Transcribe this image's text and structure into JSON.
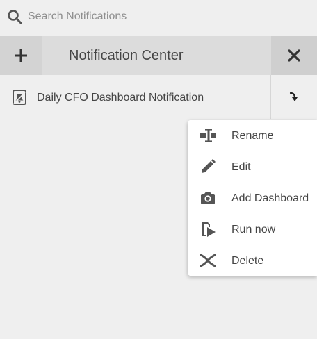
{
  "search": {
    "placeholder": "Search Notifications",
    "value": "",
    "icon": "search-icon"
  },
  "header": {
    "title": "Notification Center",
    "add_icon": "plus-icon",
    "close_icon": "close-icon"
  },
  "notifications": [
    {
      "label": "Daily CFO Dashboard Notification",
      "icon": "notification-bell-icon",
      "action_icon": "arrow-turn-down-icon"
    }
  ],
  "menu": {
    "items": [
      {
        "label": "Rename",
        "icon": "rename-cursor-icon"
      },
      {
        "label": "Edit",
        "icon": "pencil-icon"
      },
      {
        "label": "Add Dashboard",
        "icon": "camera-icon"
      },
      {
        "label": "Run now",
        "icon": "run-now-icon"
      },
      {
        "label": "Delete",
        "icon": "delete-x-icon"
      }
    ]
  },
  "colors": {
    "background": "#efefef",
    "header": "#dcdcdc",
    "icon": "#555555",
    "menu_background": "#ffffff"
  }
}
